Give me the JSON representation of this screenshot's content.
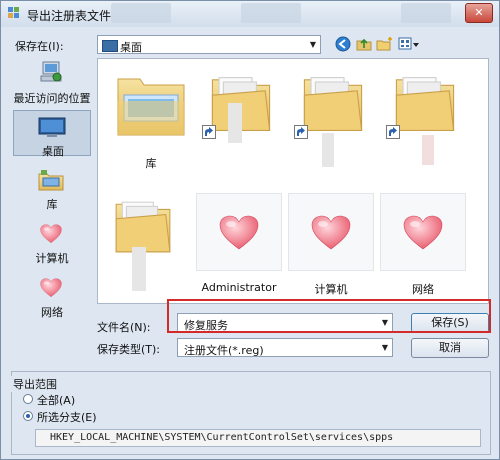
{
  "window": {
    "title": "导出注册表文件",
    "close_label": "✕"
  },
  "toolbar": {
    "look_in_label": "保存在(I):",
    "look_in_value": "桌面"
  },
  "places": [
    {
      "label": "最近访问的位置",
      "icon": "recent-places-icon"
    },
    {
      "label": "桌面",
      "icon": "desktop-icon"
    },
    {
      "label": "库",
      "icon": "libraries-icon"
    },
    {
      "label": "计算机",
      "icon": "heart-icon"
    },
    {
      "label": "网络",
      "icon": "heart-icon"
    }
  ],
  "files": [
    {
      "label": "库",
      "icon": "libraries-folder-icon"
    },
    {
      "label": "",
      "icon": "folder-shortcut-icon"
    },
    {
      "label": "",
      "icon": "folder-shortcut-icon"
    },
    {
      "label": "",
      "icon": "folder-shortcut-icon"
    },
    {
      "label": "",
      "icon": "folder-icon"
    },
    {
      "label": "Administrator",
      "icon": "heart-icon"
    },
    {
      "label": "计算机",
      "icon": "heart-icon"
    },
    {
      "label": "网络",
      "icon": "heart-icon"
    }
  ],
  "form": {
    "filename_label": "文件名(N):",
    "filename_value": "修复服务",
    "filetype_label": "保存类型(T):",
    "filetype_value": "注册文件(*.reg)",
    "save_label": "保存(S)",
    "cancel_label": "取消"
  },
  "export": {
    "title": "导出范围",
    "all_label": "全部(A)",
    "branch_label": "所选分支(E)",
    "key_path": "HKEY_LOCAL_MACHINE\\SYSTEM\\CurrentControlSet\\services\\spps"
  },
  "colors": {
    "accent": "#3a6ea5",
    "highlight": "#d52a2a",
    "heart": "#e8576a"
  }
}
